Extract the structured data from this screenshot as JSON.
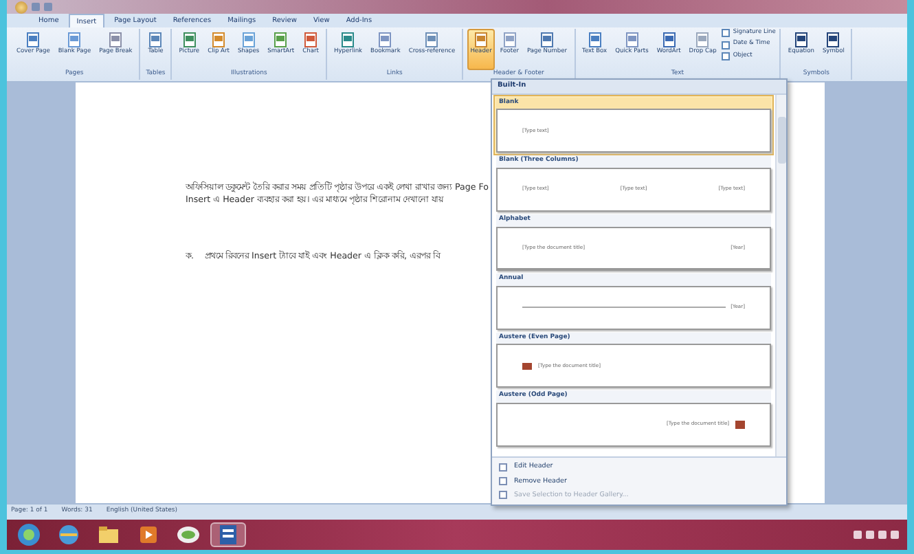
{
  "tabs": [
    {
      "label": "Home",
      "selected": false
    },
    {
      "label": "Insert",
      "selected": true
    },
    {
      "label": "Page Layout",
      "selected": false
    },
    {
      "label": "References",
      "selected": false
    },
    {
      "label": "Mailings",
      "selected": false
    },
    {
      "label": "Review",
      "selected": false
    },
    {
      "label": "View",
      "selected": false
    },
    {
      "label": "Add-Ins",
      "selected": false
    }
  ],
  "ribbon_groups": [
    {
      "label": "Pages",
      "buttons": [
        {
          "label": "Cover Page",
          "selected": false
        },
        {
          "label": "Blank Page",
          "selected": false
        },
        {
          "label": "Page Break",
          "selected": false
        }
      ]
    },
    {
      "label": "Tables",
      "buttons": [
        {
          "label": "Table",
          "selected": false
        }
      ]
    },
    {
      "label": "Illustrations",
      "buttons": [
        {
          "label": "Picture",
          "selected": false
        },
        {
          "label": "Clip Art",
          "selected": false
        },
        {
          "label": "Shapes",
          "selected": false
        },
        {
          "label": "SmartArt",
          "selected": false
        },
        {
          "label": "Chart",
          "selected": false
        }
      ]
    },
    {
      "label": "Links",
      "buttons": [
        {
          "label": "Hyperlink",
          "selected": false
        },
        {
          "label": "Bookmark",
          "selected": false
        },
        {
          "label": "Cross-reference",
          "selected": false
        }
      ]
    },
    {
      "label": "Header & Footer",
      "buttons": [
        {
          "label": "Header",
          "selected": true
        },
        {
          "label": "Footer",
          "selected": false
        },
        {
          "label": "Page Number",
          "selected": false
        }
      ]
    },
    {
      "label": "Text",
      "buttons": [
        {
          "label": "Text Box",
          "selected": false
        },
        {
          "label": "Quick Parts",
          "selected": false
        },
        {
          "label": "WordArt",
          "selected": false
        },
        {
          "label": "Drop Cap",
          "selected": false
        }
      ],
      "small": [
        "Signature Line",
        "Date & Time",
        "Object"
      ]
    },
    {
      "label": "Symbols",
      "buttons": [
        {
          "label": "Equation",
          "selected": false
        },
        {
          "label": "Symbol",
          "selected": false
        }
      ]
    }
  ],
  "document": {
    "paragraphs": [
      "অফিসিয়াল ডকুমেন্ট তৈরি করার সময় প্রতিটি পৃষ্ঠার উপরে একই লেখা রাখার জন্য Page Fo",
      "Insert এ Header ব্যবহার করা হয়। এর মাধ্যমে পৃষ্ঠার শিরোনাম দেখানো যায়"
    ],
    "list_item": {
      "marker": "ক.",
      "text": "প্রথমে রিবনের Insert ট্যাবে যাই এবং Header এ ক্লিক করি, এরপর বি"
    }
  },
  "header_gallery": {
    "title": "Built-In",
    "items": [
      {
        "label": "Blank",
        "kind": "blank",
        "selected": true,
        "texts": [
          "[Type text]"
        ]
      },
      {
        "label": "Blank (Three Columns)",
        "kind": "columns",
        "selected": false,
        "texts": [
          "[Type text]",
          "[Type text]",
          "[Type text]"
        ]
      },
      {
        "label": "Alphabet",
        "kind": "rule",
        "selected": false,
        "texts": [
          "[Type the document title]",
          "[Year]"
        ]
      },
      {
        "label": "Annual",
        "kind": "line",
        "selected": false,
        "texts": [
          "[Year]"
        ]
      },
      {
        "label": "Austere (Even Page)",
        "kind": "left_tag",
        "selected": false,
        "texts": [
          "[Type the document title]"
        ]
      },
      {
        "label": "Austere (Odd Page)",
        "kind": "right_tag",
        "selected": false,
        "texts": [
          "[Type the document title]"
        ]
      }
    ],
    "commands": [
      "Edit Header",
      "Remove Header",
      "Save Selection to Header Gallery..."
    ]
  },
  "status_bar": [
    "Page: 1 of 1",
    "Words: 31",
    "English (United States)"
  ],
  "taskbar": [
    {
      "kind": "start",
      "active": false
    },
    {
      "kind": "browser",
      "active": false
    },
    {
      "kind": "folder",
      "active": false
    },
    {
      "kind": "media",
      "active": false
    },
    {
      "kind": "chat",
      "active": false
    },
    {
      "kind": "word",
      "active": true
    }
  ]
}
